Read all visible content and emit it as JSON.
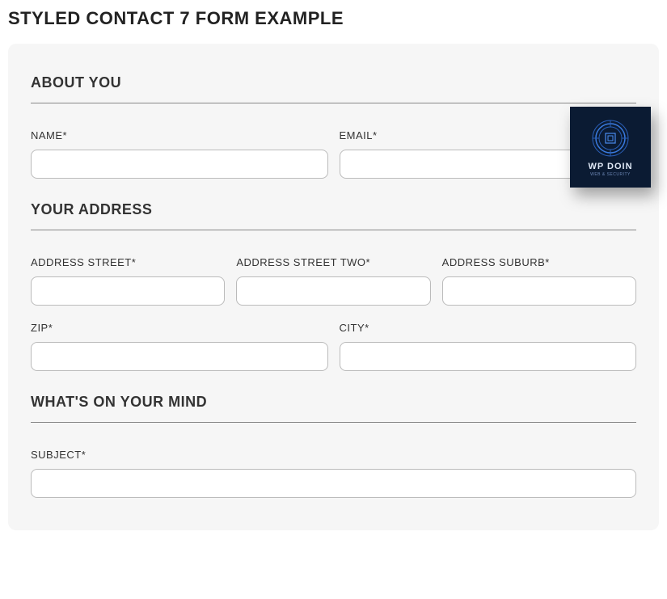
{
  "page_title": "STYLED CONTACT 7 FORM EXAMPLE",
  "sections": {
    "about": {
      "heading": "ABOUT YOU",
      "fields": {
        "name_label": "NAME*",
        "email_label": "EMAIL*"
      }
    },
    "address": {
      "heading": "YOUR ADDRESS",
      "fields": {
        "street_label": "ADDRESS STREET*",
        "street2_label": "ADDRESS STREET TWO*",
        "suburb_label": "ADDRESS SUBURB*",
        "zip_label": "ZIP*",
        "city_label": "CITY*"
      }
    },
    "mind": {
      "heading": "WHAT'S ON YOUR MIND",
      "fields": {
        "subject_label": "SUBJECT*"
      }
    }
  },
  "logo": {
    "text": "WP DOIN",
    "subtext": "WEB & SECURITY"
  }
}
